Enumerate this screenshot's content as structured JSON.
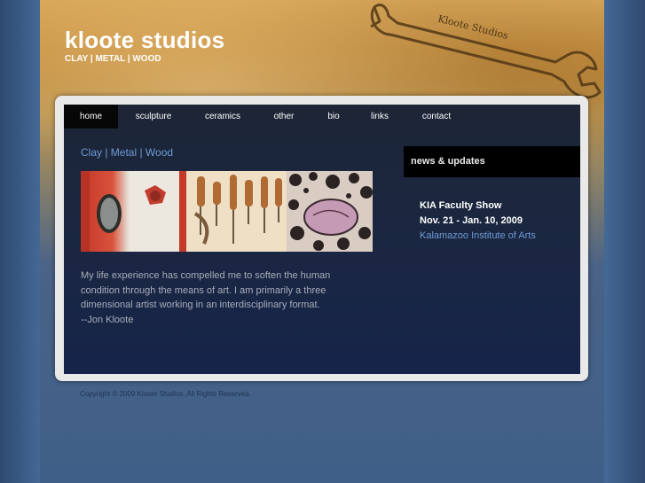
{
  "site": {
    "title": "kloote studios",
    "subtitle": "CLAY | METAL | WOOD",
    "wrench_text": "Kloote Studios"
  },
  "nav": [
    {
      "label": "home",
      "active": true
    },
    {
      "label": "sculpture",
      "active": false
    },
    {
      "label": "ceramics",
      "active": false
    },
    {
      "label": "other",
      "active": false
    },
    {
      "label": "bio",
      "active": false
    },
    {
      "label": "links",
      "active": false
    },
    {
      "label": "contact",
      "active": false
    }
  ],
  "main": {
    "section_title": "Clay | Metal | Wood",
    "intro": [
      "My life experience has compelled me to soften the human",
      "condition through the means of art. I am primarily a three",
      "dimensional artist working in an interdisciplinary format.",
      "--Jon Kloote"
    ]
  },
  "news": {
    "heading": "news & updates",
    "item_title": "KIA Faculty Show",
    "item_date": "Nov. 21 - Jan. 10, 2009",
    "item_link": "Kalamazoo Institute of Arts"
  },
  "footer": {
    "copyright": "Copyright © 2009 Kloote Studios. All Rights Reserved."
  },
  "colors": {
    "link_blue": "#6d9bd6",
    "panel_bg": "#1b2740",
    "nav_active": "#070707",
    "banner_gold": "#c99242"
  }
}
